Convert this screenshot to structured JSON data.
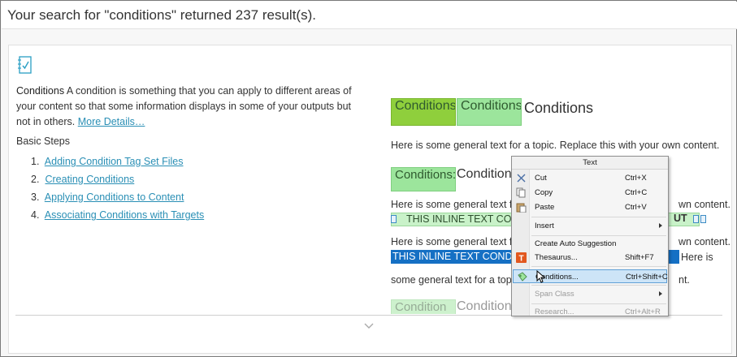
{
  "search": {
    "summary": "Your search for \"conditions\" returned 237 result(s)."
  },
  "result": {
    "icon": "topic-checklist-icon",
    "term": "Conditions",
    "description": " A condition is something that you can apply to different areas of your content so that some information displays in some of your outputs but not in others. ",
    "more_link": "More Details…",
    "basic_steps_title": "Basic Steps",
    "steps": [
      {
        "num": "1.",
        "label": "Adding Condition Tag Set Files"
      },
      {
        "num": "2.",
        "label": "Creating Conditions"
      },
      {
        "num": "3.",
        "label": "Applying Conditions to Content"
      },
      {
        "num": "4.",
        "label": "Associating Conditions with Targets"
      }
    ],
    "expand_icon": "chevron-down-icon"
  },
  "preview": {
    "tags": [
      "ConditionsBlo",
      "Conditions",
      "Conditions:chara",
      "Condition"
    ],
    "heading": "Conditions",
    "heading2": "Conditione",
    "line1": "Here is some general text for a topic. Replace this with your own content.",
    "line2a": "Here is some general text fo",
    "line2b": "wn content.",
    "inline_green": "THIS INLINE TEXT CON",
    "inline_green_end": "UT",
    "line3a": "Here is some general text fo",
    "line3b": "wn content.",
    "selected": "THIS INLINE TEXT CONDI",
    "line4_end": "Here is",
    "line5": "some general text for a topic",
    "line5_end": "nt.",
    "heading3": "Conditions"
  },
  "context_menu": {
    "title": "Text",
    "items": [
      {
        "label": "Cut",
        "shortcut": "Ctrl+X",
        "icon": "scissors-icon"
      },
      {
        "label": "Copy",
        "shortcut": "Ctrl+C",
        "icon": "copy-icon"
      },
      {
        "label": "Paste",
        "shortcut": "Ctrl+V",
        "icon": "paste-icon"
      },
      {
        "label": "Insert",
        "shortcut": "",
        "icon": ""
      },
      {
        "label": "Create Auto Suggestion",
        "shortcut": "",
        "icon": ""
      },
      {
        "label": "Thesaurus...",
        "shortcut": "Shift+F7",
        "icon": "thesaurus-icon"
      },
      {
        "label": "Conditions...",
        "shortcut": "Ctrl+Shift+C",
        "icon": "conditions-icon"
      },
      {
        "label": "Span Class",
        "shortcut": "",
        "icon": ""
      },
      {
        "label": "Research...",
        "shortcut": "Ctrl+Alt+R",
        "icon": ""
      }
    ]
  },
  "colors": {
    "link": "#2a8fb5",
    "tag_green": "#9ce59c",
    "selection_blue": "#1570c4",
    "menu_highlight": "#cde4f7"
  }
}
